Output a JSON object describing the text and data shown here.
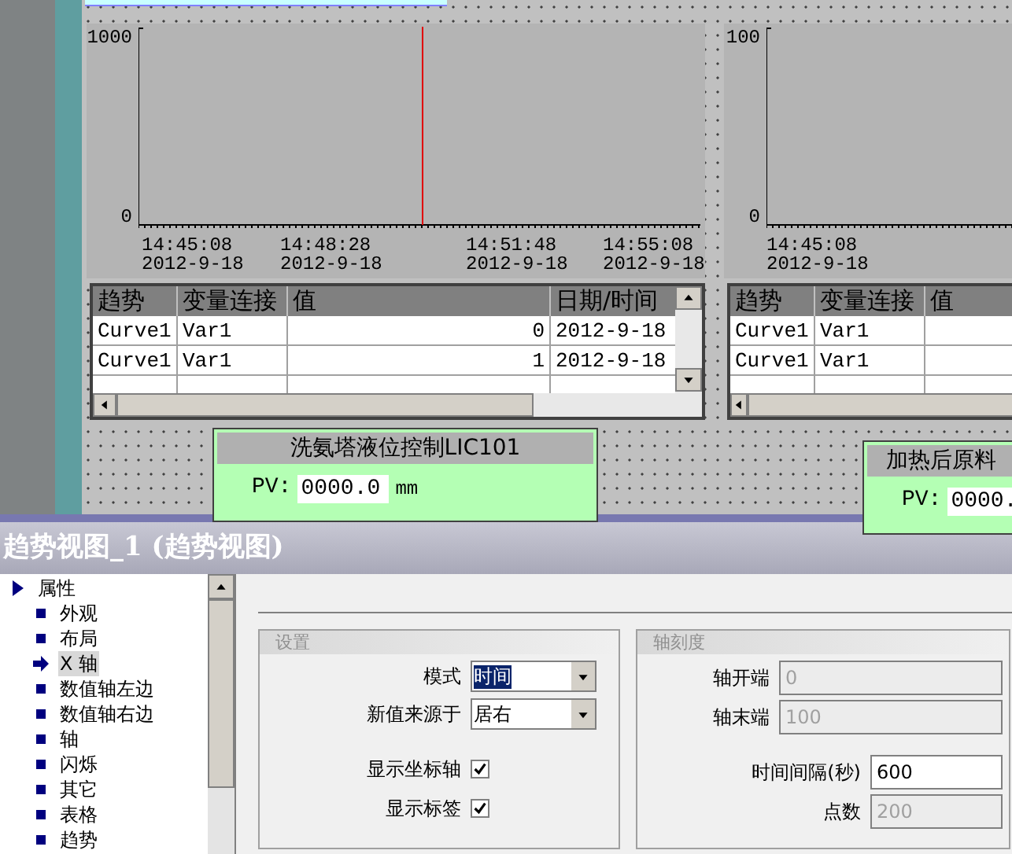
{
  "canvas": {
    "trend_views": [
      {
        "y_labels": [
          "1000",
          "0"
        ],
        "x_labels": [
          {
            "time": "14:45:08",
            "date": "2012-9-18"
          },
          {
            "time": "14:48:28",
            "date": "2012-9-18"
          },
          {
            "time": "14:51:48",
            "date": "2012-9-18"
          },
          {
            "time": "14:55:08",
            "date": "2012-9-18"
          }
        ],
        "ruler_visible": true,
        "table": {
          "columns": [
            "趋势",
            "变量连接",
            "值",
            "日期/时间"
          ],
          "rows": [
            [
              "Curve1",
              "Var1",
              "0",
              "2012-9-18"
            ],
            [
              "Curve1",
              "Var1",
              "1",
              "2012-9-18"
            ]
          ]
        }
      },
      {
        "y_labels": [
          "100",
          "0"
        ],
        "x_labels": [
          {
            "time": "14:45:08",
            "date": "2012-9-18"
          }
        ],
        "ruler_visible": false,
        "table": {
          "columns": [
            "趋势",
            "变量连接",
            "值"
          ],
          "rows": [
            [
              "Curve1",
              "Var1"
            ],
            [
              "Curve1",
              "Var1"
            ]
          ]
        }
      }
    ],
    "controllers": [
      {
        "title": "洗氨塔液位控制LIC101",
        "pv_label": "PV:",
        "pv_value": "0000.0",
        "unit": "mm"
      },
      {
        "title": "加热后原料",
        "pv_label": "PV:",
        "pv_value": "0000."
      }
    ]
  },
  "inspector": {
    "title": "趋势视图_1 (趋势视图)",
    "tree": [
      {
        "label": "属性",
        "expanded": true,
        "children": [
          {
            "label": "外观",
            "selected": false
          },
          {
            "label": "布局",
            "selected": false
          },
          {
            "label": "X 轴",
            "selected": true
          },
          {
            "label": "数值轴左边",
            "selected": false
          },
          {
            "label": "数值轴右边",
            "selected": false
          },
          {
            "label": "轴",
            "selected": false
          },
          {
            "label": "闪烁",
            "selected": false
          },
          {
            "label": "其它",
            "selected": false
          },
          {
            "label": "表格",
            "selected": false
          },
          {
            "label": "趋势",
            "selected": false
          }
        ]
      }
    ],
    "groups": [
      {
        "title": "设置",
        "rows": [
          {
            "kind": "dropdown",
            "label": "模式",
            "value": "时间",
            "highlighted": true
          },
          {
            "kind": "dropdown",
            "label": "新值来源于",
            "value": "居右",
            "highlighted": false
          },
          {
            "kind": "checkbox",
            "label": "显示坐标轴",
            "checked": true
          },
          {
            "kind": "checkbox",
            "label": "显示标签",
            "checked": true
          }
        ]
      },
      {
        "title": "轴刻度",
        "rows": [
          {
            "kind": "text",
            "label": "轴开端",
            "value": "0",
            "disabled": true
          },
          {
            "kind": "text",
            "label": "轴末端",
            "value": "100",
            "disabled": true
          },
          {
            "kind": "text",
            "label": "时间间隔(秒)",
            "value": "600",
            "disabled": false
          },
          {
            "kind": "text",
            "label": "点数",
            "value": "200",
            "disabled": true
          }
        ]
      }
    ]
  }
}
